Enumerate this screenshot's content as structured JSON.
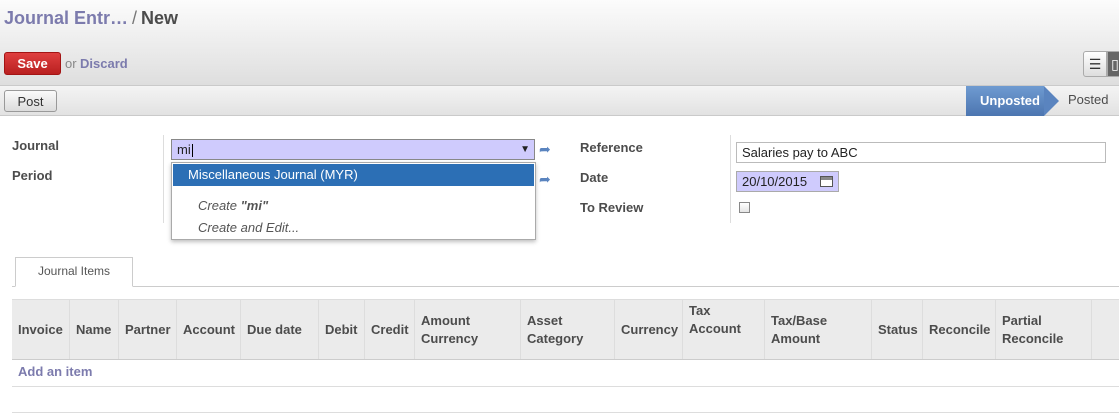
{
  "breadcrumb": {
    "parent": "Journal Entr…",
    "separator": "/",
    "current": "New"
  },
  "toolbar": {
    "save_label": "Save",
    "or_label": "or",
    "discard_label": "Discard"
  },
  "view_switch": {
    "list_icon": "list-icon",
    "form_icon": "form-icon"
  },
  "statusbar": {
    "post_label": "Post",
    "stages": [
      {
        "label": "Unposted",
        "active": true
      },
      {
        "label": "Posted",
        "active": false
      }
    ],
    "active_color": "#5a84bf"
  },
  "form": {
    "journal": {
      "label": "Journal",
      "value": "mi",
      "dropdown": {
        "selected": "Miscellaneous Journal (MYR)",
        "create_prefix": "Create ",
        "create_term": "\"mi\"",
        "create_edit": "Create and Edit..."
      }
    },
    "period": {
      "label": "Period"
    },
    "reference": {
      "label": "Reference",
      "value": "Salaries pay to ABC"
    },
    "date": {
      "label": "Date",
      "value": "20/10/2015"
    },
    "to_review": {
      "label": "To Review",
      "checked": false
    }
  },
  "notebook": {
    "tab_label": "Journal Items",
    "columns": [
      "Invoice",
      "Name",
      "Partner",
      "Account",
      "Due date",
      "Debit",
      "Credit",
      "Amount Currency",
      "Asset Category",
      "Currency",
      "Tax Account",
      "Tax/Base Amount",
      "Status",
      "Reconcile",
      "Partial Reconcile"
    ],
    "add_item_label": "Add an item"
  },
  "colors": {
    "save_red": "#c9302c",
    "link_purple": "#7c7bad",
    "input_highlight": "#cfcbfd",
    "dropdown_selected": "#2c6fb5"
  }
}
